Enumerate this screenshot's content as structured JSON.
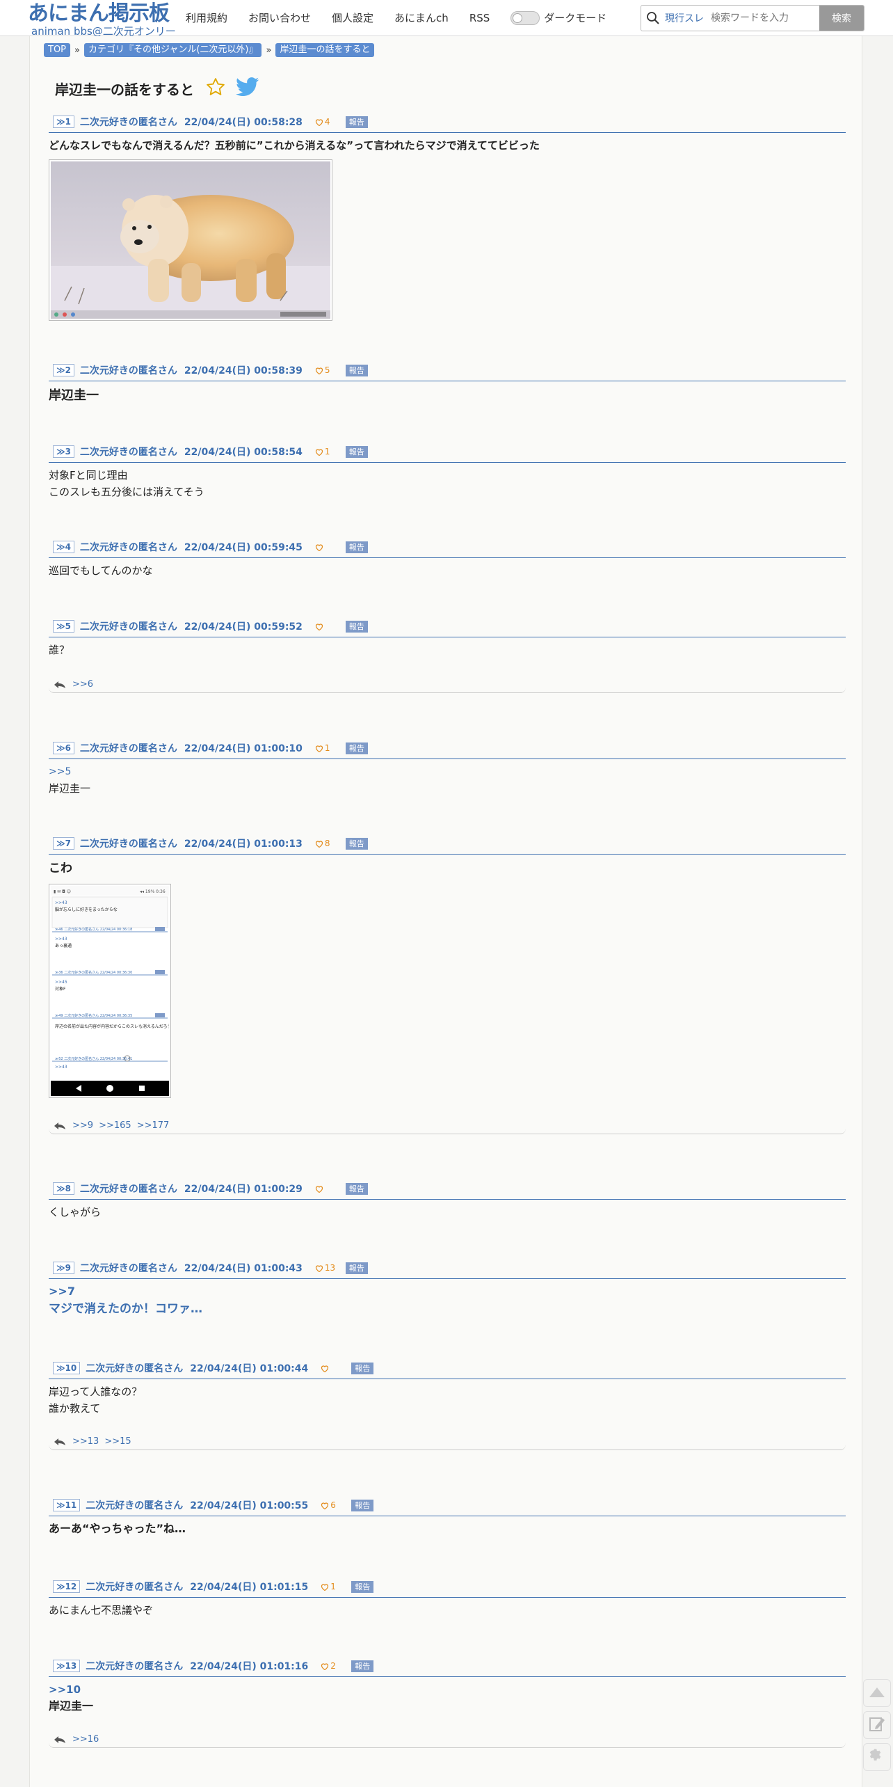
{
  "header": {
    "logo_main": "あにまん掲示板",
    "logo_sub": "animan bbs@二次元オンリー",
    "nav": [
      "利用規約",
      "お問い合わせ",
      "個人設定",
      "あにまんch",
      "RSS"
    ],
    "dark_mode_label": "ダークモード",
    "search_scope": "現行スレ",
    "search_placeholder": "検索ワードを入力",
    "search_button": "検索"
  },
  "breadcrumb": [
    "TOP",
    "カテゴリ『その他ジャンル(二次元以外)』",
    "岸辺圭一の話をすると"
  ],
  "breadcrumb_sep": "»",
  "thread": {
    "title": "岸辺圭一の話をすると"
  },
  "colors": {
    "accent": "#3d6fb0",
    "like": "#e38b1a",
    "report": "#7e9ac8"
  },
  "posts": [
    {
      "num": "≫1",
      "name": "二次元好きの匿名さん",
      "date": "22/04/24(日) 00:58:28",
      "likes": "4",
      "report": "報告",
      "body": [
        "どんなスレでもなんで消えるんだ？五秒前に”これから消えるな”って言われたらマジで消えててビビった"
      ],
      "image": "polar-bear-photo"
    },
    {
      "num": "≫2",
      "name": "二次元好きの匿名さん",
      "date": "22/04/24(日) 00:58:39",
      "likes": "5",
      "report": "報告",
      "body": [
        "岸辺圭一"
      ]
    },
    {
      "num": "≫3",
      "name": "二次元好きの匿名さん",
      "date": "22/04/24(日) 00:58:54",
      "likes": "1",
      "report": "報告",
      "body": [
        "対象Fと同じ理由",
        "このスレも五分後には消えてそう"
      ]
    },
    {
      "num": "≫4",
      "name": "二次元好きの匿名さん",
      "date": "22/04/24(日) 00:59:45",
      "likes": "",
      "report": "報告",
      "body": [
        "巡回でもしてんのかな"
      ]
    },
    {
      "num": "≫5",
      "name": "二次元好きの匿名さん",
      "date": "22/04/24(日) 00:59:52",
      "likes": "",
      "report": "報告",
      "body": [
        "誰？"
      ],
      "replies": [
        ">>6"
      ]
    },
    {
      "num": "≫6",
      "name": "二次元好きの匿名さん",
      "date": "22/04/24(日) 01:00:10",
      "likes": "1",
      "report": "報告",
      "anchor": ">>5",
      "body": [
        "岸辺圭一"
      ]
    },
    {
      "num": "≫7",
      "name": "二次元好きの匿名さん",
      "date": "22/04/24(日) 01:00:13",
      "likes": "8",
      "report": "報告",
      "body": [
        "こわ"
      ],
      "image": "phone-screenshot",
      "replies": [
        ">>9",
        ">>165",
        ">>177"
      ]
    },
    {
      "num": "≫8",
      "name": "二次元好きの匿名さん",
      "date": "22/04/24(日) 01:00:29",
      "likes": "",
      "report": "報告",
      "body": [
        "くしゃがら"
      ]
    },
    {
      "num": "≫9",
      "name": "二次元好きの匿名さん",
      "date": "22/04/24(日) 01:00:43",
      "likes": "13",
      "report": "報告",
      "anchor": ">>7",
      "body": [
        "マジで消えたのか！コワァ…"
      ]
    },
    {
      "num": "≫10",
      "name": "二次元好きの匿名さん",
      "date": "22/04/24(日) 01:00:44",
      "likes": "",
      "report": "報告",
      "body": [
        "岸辺って人誰なの？",
        "誰か教えて"
      ],
      "replies": [
        ">>13",
        ">>15"
      ]
    },
    {
      "num": "≫11",
      "name": "二次元好きの匿名さん",
      "date": "22/04/24(日) 01:00:55",
      "likes": "6",
      "report": "報告",
      "body": [
        "あーあ“やっちゃった”ね…"
      ]
    },
    {
      "num": "≫12",
      "name": "二次元好きの匿名さん",
      "date": "22/04/24(日) 01:01:15",
      "likes": "1",
      "report": "報告",
      "body": [
        "あにまん七不思議やぞ"
      ]
    },
    {
      "num": "≫13",
      "name": "二次元好きの匿名さん",
      "date": "22/04/24(日) 01:01:16",
      "likes": "2",
      "report": "報告",
      "anchor": ">>10",
      "body": [
        "岸辺圭一"
      ],
      "replies": [
        ">>16"
      ]
    }
  ],
  "screenshot_text": {
    "line1": "脳が忘らしに好きをまったからな",
    "line2": "あっ裏通",
    "line3": "対象F",
    "line4": "岸辺の名前が出た内容が内容だからこのスレも消えるんだろうな"
  }
}
